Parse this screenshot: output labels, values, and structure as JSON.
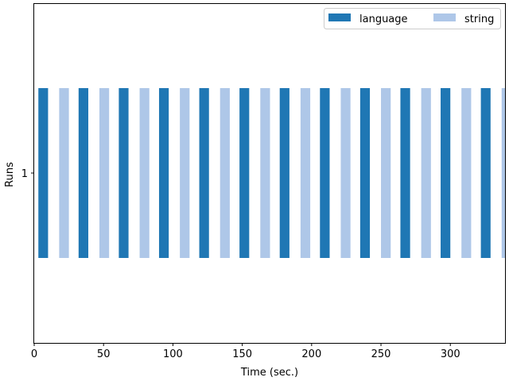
{
  "chart_data": {
    "type": "bar",
    "orientation": "timeline",
    "xlabel": "Time (sec.)",
    "ylabel": "Runs",
    "xlim": [
      0,
      340
    ],
    "xticks": [
      0,
      50,
      100,
      150,
      200,
      250,
      300
    ],
    "yticks": [
      "1"
    ],
    "grid": false,
    "legend_position": "top-right",
    "series": [
      {
        "name": "language",
        "color": "#1f77b4",
        "segments": [
          [
            3,
            10
          ],
          [
            32,
            39
          ],
          [
            61,
            68
          ],
          [
            90,
            97
          ],
          [
            119,
            126
          ],
          [
            148,
            155
          ],
          [
            177,
            184
          ],
          [
            206,
            213
          ],
          [
            235,
            242
          ],
          [
            264,
            271
          ],
          [
            293,
            300
          ],
          [
            322,
            329
          ]
        ]
      },
      {
        "name": "string",
        "color": "#aec7e8",
        "segments": [
          [
            18,
            25
          ],
          [
            47,
            54
          ],
          [
            76,
            83
          ],
          [
            105,
            112
          ],
          [
            134,
            141
          ],
          [
            163,
            170
          ],
          [
            192,
            199
          ],
          [
            221,
            228
          ],
          [
            250,
            257
          ],
          [
            279,
            286
          ],
          [
            308,
            315
          ],
          [
            337,
            344
          ]
        ]
      }
    ]
  }
}
